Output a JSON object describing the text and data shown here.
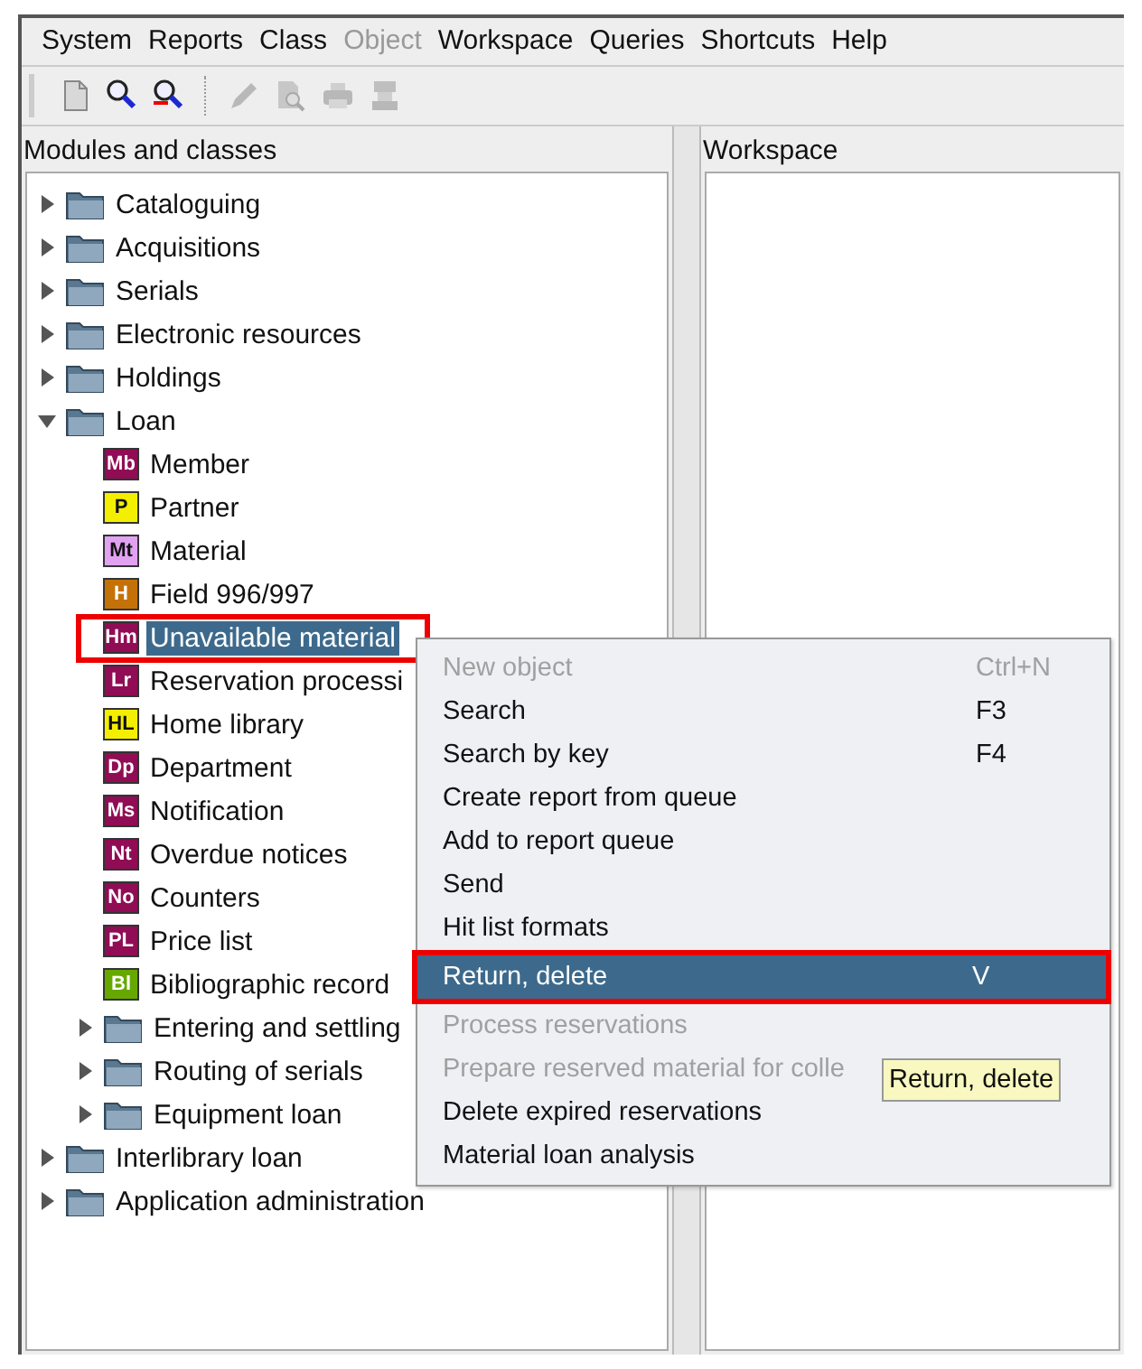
{
  "menu_bar": [
    {
      "label": "System",
      "disabled": false
    },
    {
      "label": "Reports",
      "disabled": false
    },
    {
      "label": "Class",
      "disabled": false
    },
    {
      "label": "Object",
      "disabled": true
    },
    {
      "label": "Workspace",
      "disabled": false
    },
    {
      "label": "Queries",
      "disabled": false
    },
    {
      "label": "Shortcuts",
      "disabled": false
    },
    {
      "label": "Help",
      "disabled": false
    }
  ],
  "toolbar": [
    {
      "kind": "new",
      "disabled": false
    },
    {
      "kind": "search",
      "disabled": false
    },
    {
      "kind": "search-key",
      "disabled": false
    },
    {
      "kind": "separator"
    },
    {
      "kind": "edit",
      "disabled": true
    },
    {
      "kind": "preview",
      "disabled": true
    },
    {
      "kind": "print",
      "disabled": true
    },
    {
      "kind": "device",
      "disabled": true
    }
  ],
  "modules": {
    "title": "Modules and classes",
    "tree": [
      {
        "kind": "folder",
        "label": "Cataloguing",
        "expanded": false
      },
      {
        "kind": "folder",
        "label": "Acquisitions",
        "expanded": false
      },
      {
        "kind": "folder",
        "label": "Serials",
        "expanded": false
      },
      {
        "kind": "folder",
        "label": "Electronic resources",
        "expanded": false
      },
      {
        "kind": "folder",
        "label": "Holdings",
        "expanded": false
      },
      {
        "kind": "folder",
        "label": "Loan",
        "expanded": true,
        "children": [
          {
            "kind": "class",
            "badge": "Mb",
            "color": "#900c55",
            "label": "Member",
            "selected": false
          },
          {
            "kind": "class",
            "badge": "P",
            "color": "#f4ef00",
            "label": "Partner",
            "selected": false
          },
          {
            "kind": "class",
            "badge": "Mt",
            "color": "#e2a2f2",
            "label": "Material",
            "selected": false
          },
          {
            "kind": "class",
            "badge": "H",
            "color": "#c47208",
            "label": "Field 996/997",
            "selected": false
          },
          {
            "kind": "class",
            "badge": "Hm",
            "color": "#900c55",
            "label": "Unavailable material",
            "selected": true,
            "annotated": true
          },
          {
            "kind": "class",
            "badge": "Lr",
            "color": "#900c55",
            "label": "Reservation processi",
            "selected": false
          },
          {
            "kind": "class",
            "badge": "HL",
            "color": "#f4ef00",
            "label": "Home library",
            "selected": false
          },
          {
            "kind": "class",
            "badge": "Dp",
            "color": "#900c55",
            "label": "Department",
            "selected": false
          },
          {
            "kind": "class",
            "badge": "Ms",
            "color": "#900c55",
            "label": "Notification",
            "selected": false
          },
          {
            "kind": "class",
            "badge": "Nt",
            "color": "#900c55",
            "label": "Overdue notices",
            "selected": false
          },
          {
            "kind": "class",
            "badge": "No",
            "color": "#900c55",
            "label": "Counters",
            "selected": false
          },
          {
            "kind": "class",
            "badge": "PL",
            "color": "#900c55",
            "label": "Price list",
            "selected": false
          },
          {
            "kind": "class",
            "badge": "Bl",
            "color": "#66a800",
            "label": "Bibliographic record",
            "selected": false
          },
          {
            "kind": "folder",
            "label": "Entering and settling",
            "expanded": false
          },
          {
            "kind": "folder",
            "label": "Routing of serials",
            "expanded": false
          },
          {
            "kind": "folder",
            "label": "Equipment loan",
            "expanded": false
          }
        ]
      },
      {
        "kind": "folder",
        "label": "Interlibrary loan",
        "expanded": false
      },
      {
        "kind": "folder",
        "label": "Application administration",
        "expanded": false
      }
    ]
  },
  "workspace": {
    "title": "Workspace"
  },
  "context_menu": {
    "items": [
      {
        "label": "New object",
        "shortcut": "Ctrl+N",
        "disabled": true,
        "selected": false
      },
      {
        "label": "Search",
        "shortcut": "F3",
        "disabled": false,
        "selected": false
      },
      {
        "label": "Search by key",
        "shortcut": "F4",
        "disabled": false,
        "selected": false
      },
      {
        "label": "Create report from queue",
        "disabled": false,
        "selected": false
      },
      {
        "label": "Add to report queue",
        "disabled": false,
        "selected": false
      },
      {
        "label": "Send",
        "disabled": false,
        "selected": false
      },
      {
        "label": "Hit list formats",
        "disabled": false,
        "selected": false
      },
      {
        "label": "Return, delete",
        "shortcut": "V",
        "disabled": false,
        "selected": true,
        "annotated": true
      },
      {
        "label": "Process reservations",
        "disabled": true,
        "selected": false
      },
      {
        "label": "Prepare reserved material for colle",
        "disabled": true,
        "selected": false
      },
      {
        "label": "Delete expired reservations",
        "disabled": false,
        "selected": false
      },
      {
        "label": "Material loan analysis",
        "disabled": false,
        "selected": false
      }
    ]
  },
  "tooltip": {
    "text": "Return, delete"
  }
}
